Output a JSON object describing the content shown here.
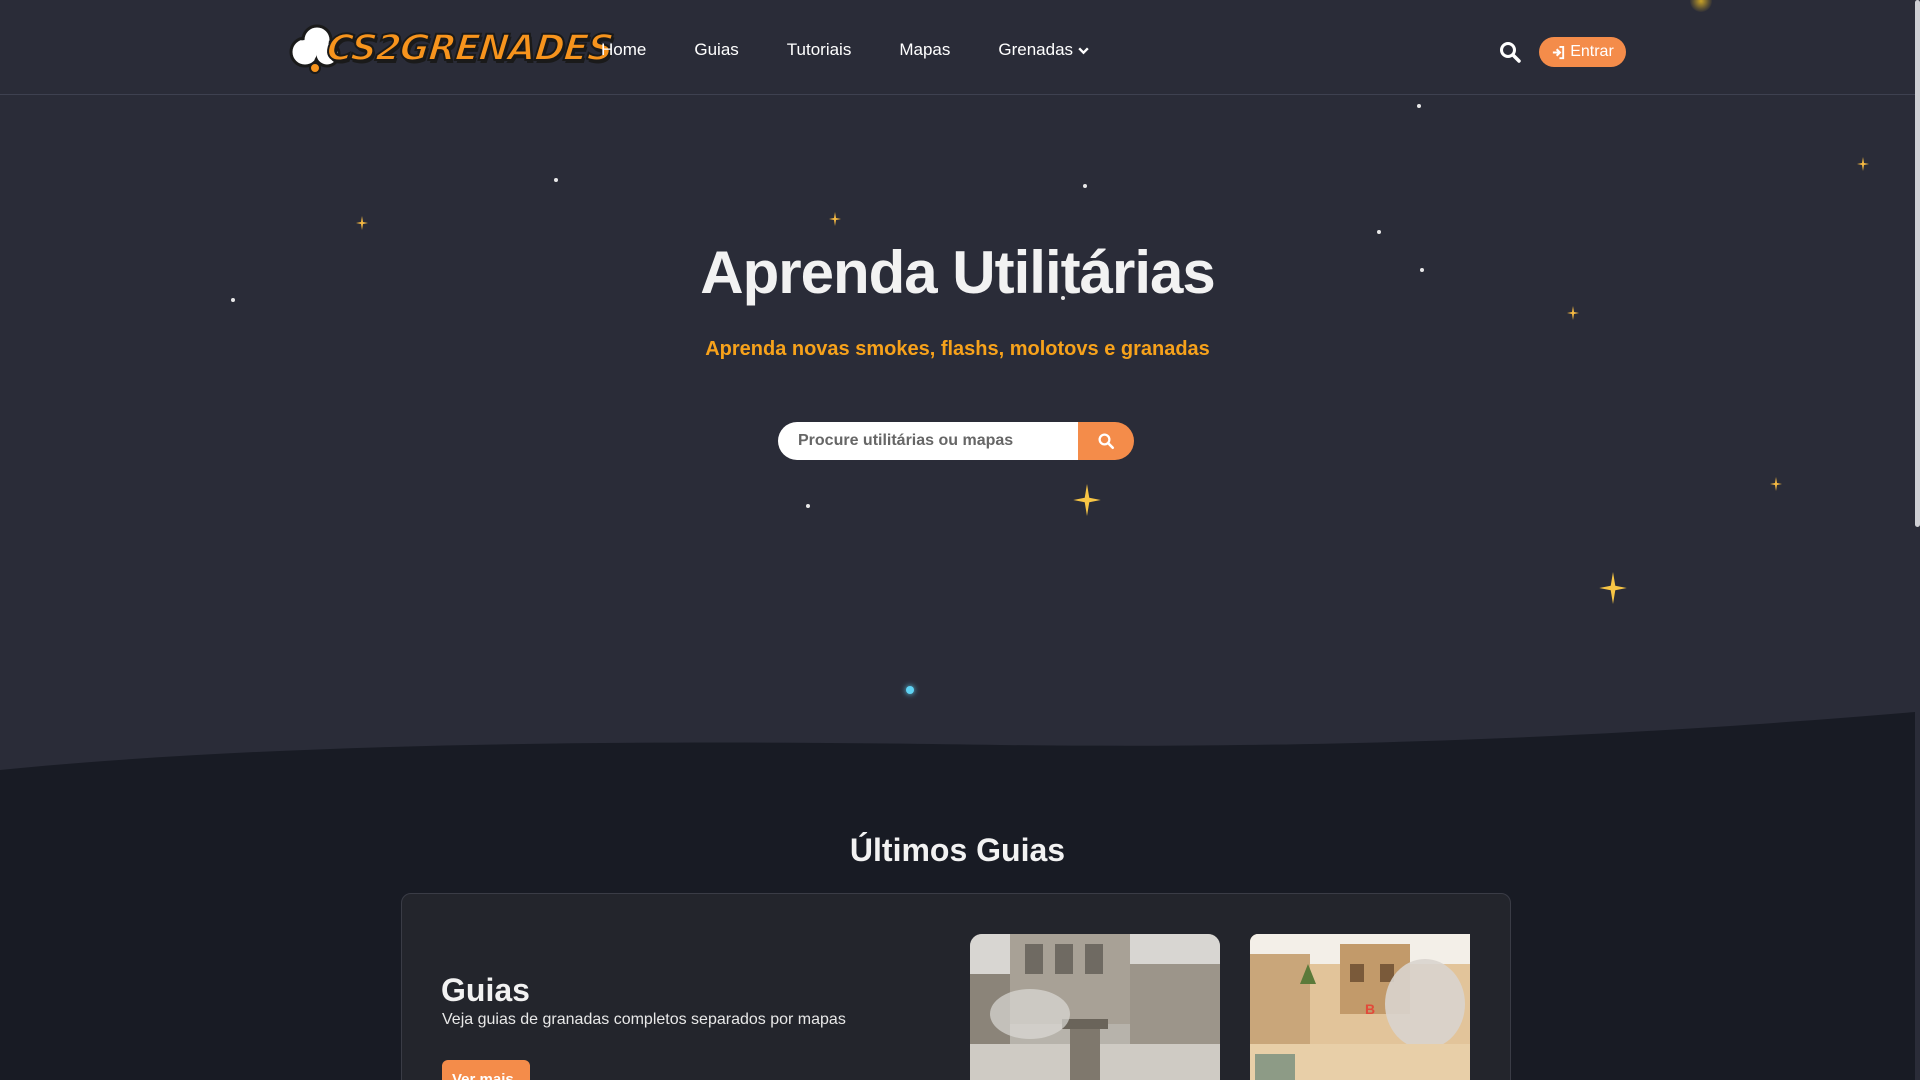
{
  "header": {
    "logo_text": "CS2GRENADES",
    "nav": [
      {
        "label": "Home"
      },
      {
        "label": "Guias"
      },
      {
        "label": "Tutoriais"
      },
      {
        "label": "Mapas"
      },
      {
        "label": "Grenadas",
        "has_dropdown": true
      }
    ],
    "search_icon": "search-icon",
    "login_label": "Entrar",
    "login_icon": "sign-in-icon"
  },
  "hero": {
    "title": "Aprenda Utilitárias",
    "subtitle": "Aprenda novas smokes, flashs, molotovs e granadas",
    "search_placeholder": "Procure utilitárias ou mapas"
  },
  "latest": {
    "title": "Últimos Guias",
    "card": {
      "title": "Guias",
      "description": "Veja guias de granadas completos separados por mapas",
      "button_label": "Ver mais"
    }
  },
  "colors": {
    "accent": "#f48c4a",
    "subtitle": "#f7a21b",
    "background": "#2a2c38",
    "section_background": "#181b24"
  }
}
